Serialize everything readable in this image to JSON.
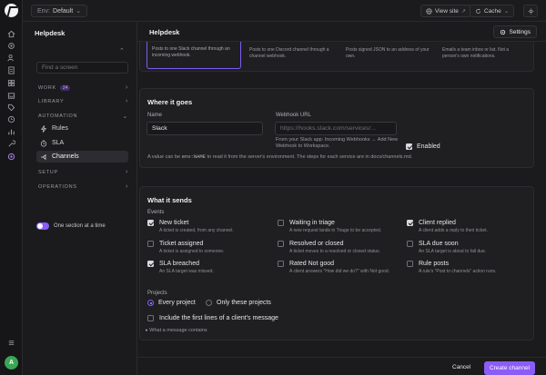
{
  "topbar": {
    "env_prefix": "Env:",
    "env_value": "Default",
    "view_site": "View site",
    "cache": "Cache"
  },
  "sidebar": {
    "title": "Helpdesk",
    "search_placeholder": "Find a screen",
    "sections": {
      "work": "WORK",
      "work_badge": "24",
      "library": "LIBRARY",
      "automation": "AUTOMATION",
      "setup": "SETUP",
      "operations": "OPERATIONS"
    },
    "items": {
      "rules": "Rules",
      "sla": "SLA",
      "channels": "Channels"
    },
    "toggle_label": "One section at a time"
  },
  "main": {
    "title": "Helpdesk",
    "settings_label": "Settings",
    "providers": [
      {
        "desc": "Posts to one Slack channel through an incoming webhook.",
        "selected": true
      },
      {
        "desc": "Posts to one Discord channel through a channel webhook.",
        "selected": false
      },
      {
        "desc": "Posts signed JSON to an address of your own.",
        "selected": false
      },
      {
        "desc": "Emails a team inbox or list. Not a person's own notifications.",
        "selected": false
      }
    ],
    "where": {
      "heading": "Where it goes",
      "name_label": "Name",
      "name_value": "Slack",
      "webhook_label": "Webhook URL",
      "webhook_placeholder": "https://hooks.slack.com/services/...",
      "webhook_note": "From your Slack app: Incoming Webhooks → Add New Webhook to Workspace.",
      "enabled_label": "Enabled",
      "env_note_pre": "A value can be",
      "env_note_code": "env:NAME",
      "env_note_post": "to read it from the server's environment. The steps for each service are in docs/channels.md."
    },
    "what": {
      "heading": "What it sends",
      "events_label": "Events",
      "events": [
        {
          "title": "New ticket",
          "desc": "A ticket is created, from any channel.",
          "checked": true
        },
        {
          "title": "Waiting in triage",
          "desc": "A new request lands in Triage to be accepted.",
          "checked": false
        },
        {
          "title": "Client replied",
          "desc": "A client adds a reply to their ticket.",
          "checked": true
        },
        {
          "title": "Ticket assigned",
          "desc": "A ticket is assigned to someone.",
          "checked": false
        },
        {
          "title": "Resolved or closed",
          "desc": "A ticket moves to a resolved or closed status.",
          "checked": false
        },
        {
          "title": "SLA due soon",
          "desc": "An SLA target is about to fall due.",
          "checked": false
        },
        {
          "title": "SLA breached",
          "desc": "An SLA target was missed.",
          "checked": true
        },
        {
          "title": "Rated Not good",
          "desc": "A client answers \"How did we do?\" with Not good.",
          "checked": false
        },
        {
          "title": "Rule posts",
          "desc": "A rule's \"Post to channels\" action runs.",
          "checked": false
        }
      ],
      "projects_label": "Projects",
      "every_project": "Every project",
      "only_these": "Only these projects",
      "include_first_lines": "Include the first lines of a client's message",
      "what_contains": "▸ What a message contains"
    },
    "footer": {
      "cancel": "Cancel",
      "create": "Create channel"
    }
  },
  "colors": {
    "accent": "#8b5cf6",
    "background": "#1b1b1d",
    "card": "#1f1f22"
  }
}
